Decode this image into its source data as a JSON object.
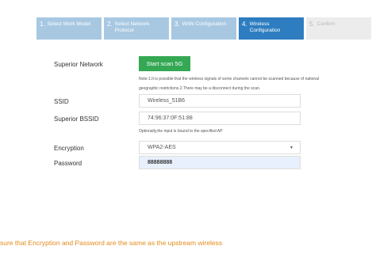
{
  "wizard": {
    "steps": [
      {
        "num": "1.",
        "label": "Select Work Model",
        "state": "done"
      },
      {
        "num": "2.",
        "label": "Select Network Protocol",
        "state": "done"
      },
      {
        "num": "3.",
        "label": "WAN Configuration",
        "state": "done"
      },
      {
        "num": "4.",
        "label": "Wireless Configuration",
        "state": "active"
      },
      {
        "num": "5.",
        "label": "Confirm",
        "state": "upcoming"
      }
    ]
  },
  "form": {
    "superior_network": {
      "label": "Superior Network",
      "scan_button": "Start scan 5G",
      "note_line1": "Note:1.It is possible that the wireless signals of some channels cannot be scanned because of national",
      "note_line2": "geographic restrictions.2.There may be a disconnect during the scan."
    },
    "ssid": {
      "label": "SSID",
      "value": "Wireless_51B6"
    },
    "superior_bssid": {
      "label": "Superior BSSID",
      "value": "74:96:37:0F:51:88",
      "hint": "Optionally,the input is bound to the specified AP"
    },
    "encryption": {
      "label": "Encryption",
      "value": "WPA2-AES"
    },
    "password": {
      "label": "Password",
      "value": "88888888"
    }
  },
  "warning": " sure that Encryption and Password are the same as the upstream wireless",
  "colors": {
    "step_done": "#a8c8e2",
    "step_active": "#2e7dc0",
    "step_upcoming": "#ececec",
    "scan_button": "#34a853",
    "warning_text": "#e38b1a",
    "password_bg": "#e8f0fe"
  },
  "icons": {
    "encryption_dropdown": "chevron-down-icon"
  }
}
